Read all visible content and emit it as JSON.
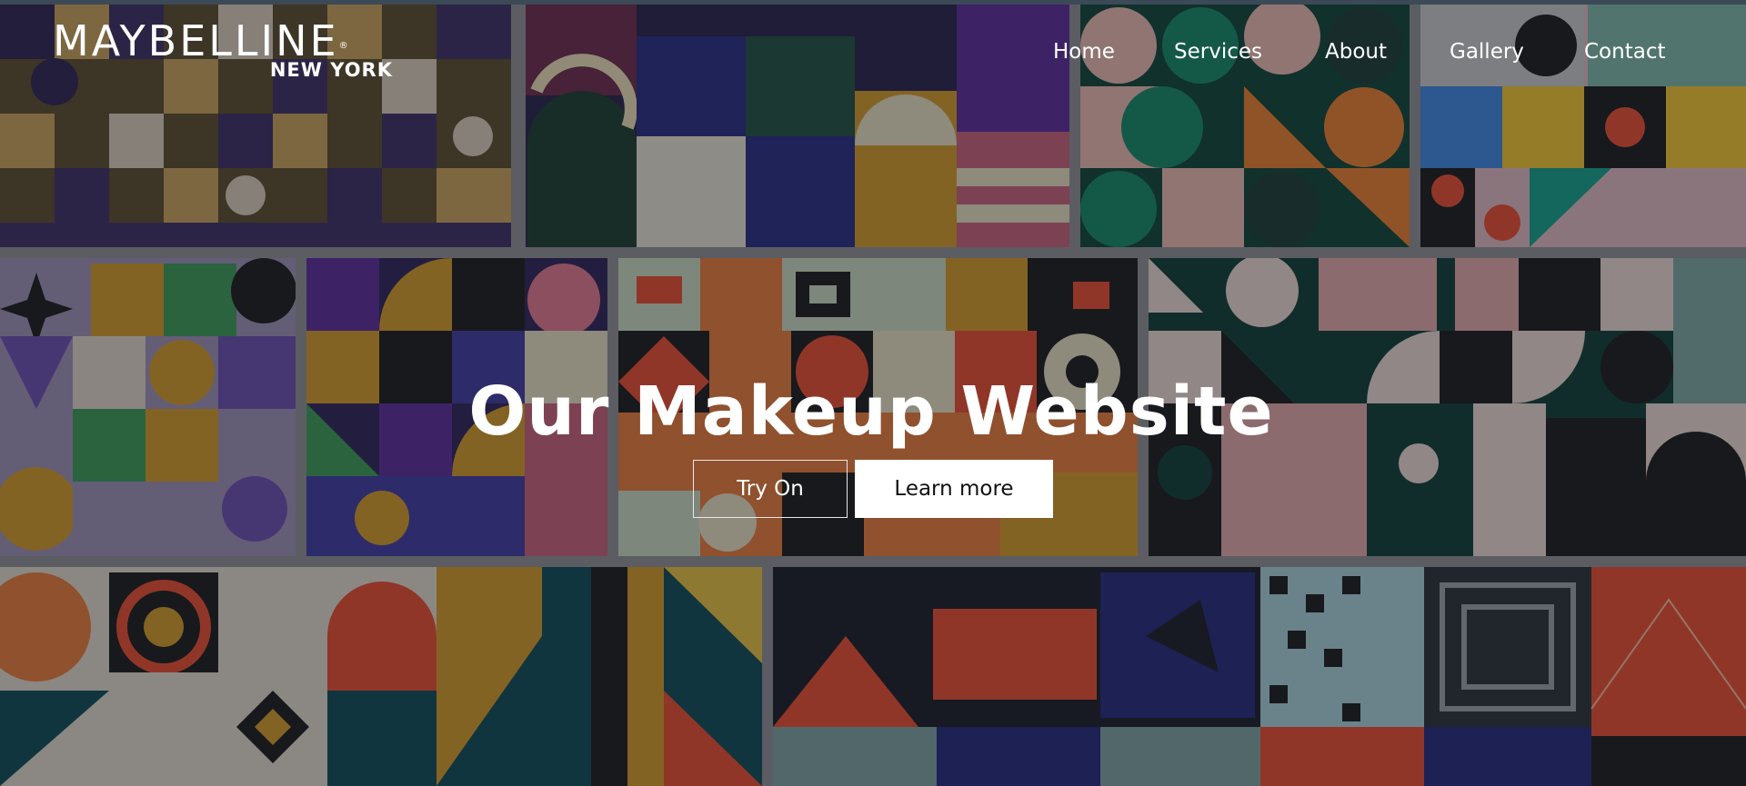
{
  "brand": {
    "name": "MAYBELLINE",
    "trademark": "®",
    "location": "NEW YORK"
  },
  "nav": {
    "items": [
      "Home",
      "Services",
      "About",
      "Gallery",
      "Contact"
    ]
  },
  "hero": {
    "title": "Our Makeup Website",
    "primary_button": "Try On",
    "secondary_button": "Learn more",
    "background": "geometric-pattern-mosaic"
  },
  "colors": {
    "text": "#ffffff",
    "overlay": "#16181e",
    "button_fill": "#ffffff",
    "button_text": "#111111"
  }
}
